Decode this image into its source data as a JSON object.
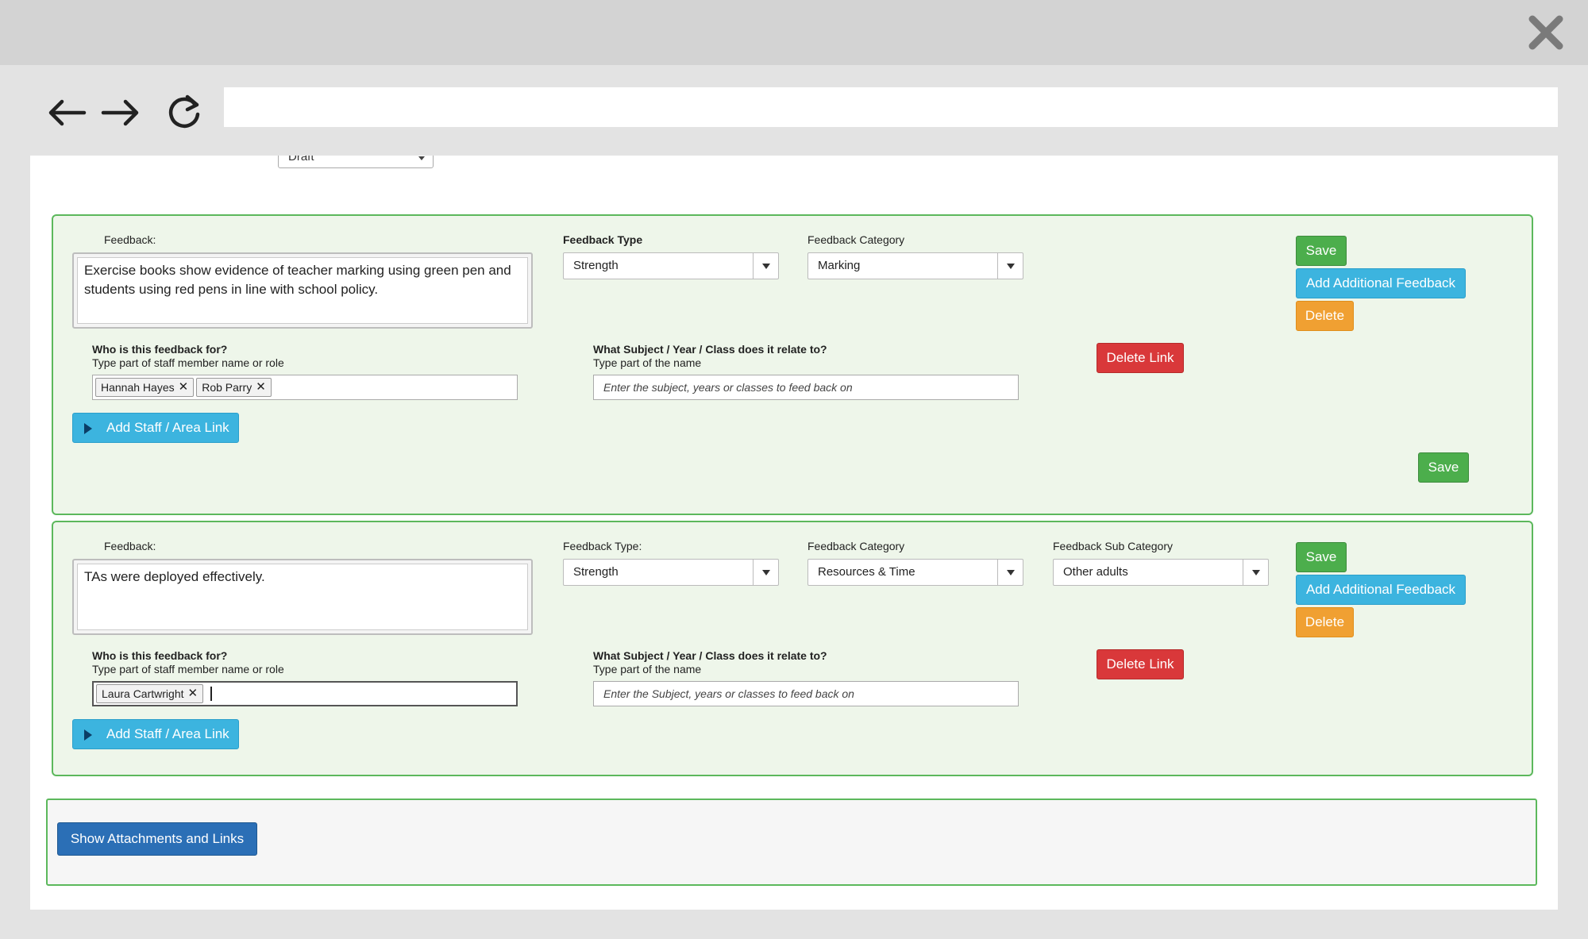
{
  "browser": {
    "address": ""
  },
  "page": {
    "status_value": "Draft"
  },
  "feedback_items": [
    {
      "feedback_label": "Feedback:",
      "feedback_text": "Exercise books show evidence of teacher marking using green pen and students using red pens in line with school policy.",
      "type_label": "Feedback Type",
      "type_value": "Strength",
      "category_label": "Feedback Category",
      "category_value": "Marking",
      "who_label": "Who is this feedback for?",
      "who_hint": "Type part of staff member name or role",
      "who_tags": [
        "Hannah Hayes",
        "Rob Parry"
      ],
      "subject_label": "What Subject / Year / Class does it relate to?",
      "subject_hint": "Type part of the name",
      "subject_placeholder": "Enter the subject, years or classes to feed back on",
      "delete_link_label": "Delete Link",
      "add_staff_label": "Add Staff / Area Link",
      "save_label": "Save",
      "add_additional_label": "Add Additional Feedback",
      "delete_label": "Delete",
      "bottom_save_label": "Save"
    },
    {
      "feedback_label": "Feedback:",
      "feedback_text": "TAs were deployed effectively.",
      "type_label": "Feedback Type:",
      "type_value": "Strength",
      "category_label": "Feedback Category",
      "category_value": "Resources & Time",
      "subcategory_label": "Feedback Sub Category",
      "subcategory_value": "Other adults",
      "who_label": "Who is this feedback for?",
      "who_hint": "Type part of staff member name or role",
      "who_tags": [
        "Laura Cartwright"
      ],
      "subject_label": "What Subject / Year / Class does it relate to?",
      "subject_hint": "Type part of the name",
      "subject_placeholder": "Enter the Subject, years or classes to feed back on",
      "delete_link_label": "Delete Link",
      "add_staff_label": "Add Staff / Area Link",
      "save_label": "Save",
      "add_additional_label": "Add Additional Feedback",
      "delete_label": "Delete"
    }
  ],
  "attachments": {
    "button_label": "Show Attachments and Links"
  },
  "icons": {
    "close": "close-icon",
    "back": "arrow-left-icon",
    "forward": "arrow-right-icon",
    "reload": "reload-icon"
  },
  "colors": {
    "panel_border": "#5cb85c",
    "panel_bg": "#eef6ea",
    "save": "#4cae4c",
    "info": "#3cb4df",
    "warning": "#f0a032",
    "danger": "#d9383a",
    "primary": "#2b6fb6"
  }
}
